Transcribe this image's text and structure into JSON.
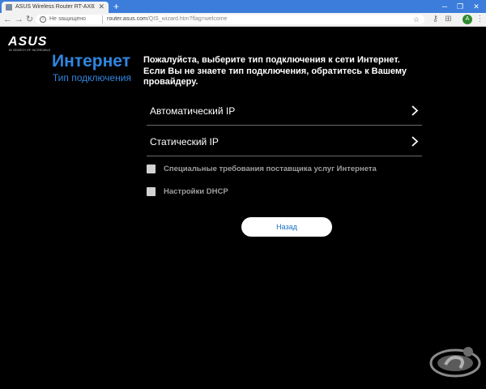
{
  "browser": {
    "tab": {
      "title": "ASUS Wireless Router RT-AX82U"
    },
    "omnibox": {
      "security": "Не защищено",
      "host": "router.asus.com",
      "path": "/QIS_wizard.htm?flag=welcome"
    },
    "profile_initial": "A"
  },
  "logo": {
    "word": "ASUS",
    "tagline": "IN SEARCH OF INCREDIBLE"
  },
  "header": {
    "title": "Интернет",
    "subtitle": "Тип подключения"
  },
  "instructions": "Пожалуйста, выберите тип подключения к сети Интернет. Если Вы не знаете тип подключения, обратитесь к Вашему провайдеру.",
  "options": [
    {
      "label": "Автоматический IP"
    },
    {
      "label": "Статический IP"
    }
  ],
  "checkboxes": [
    {
      "label": "Специальные требования поставщика услуг Интернета",
      "checked": false
    },
    {
      "label": "Настройки DHCP",
      "checked": false
    }
  ],
  "back_button": "Назад",
  "colors": {
    "accent": "#2f86e0",
    "background": "#000000",
    "tab_strip": "#3c7ddb"
  }
}
